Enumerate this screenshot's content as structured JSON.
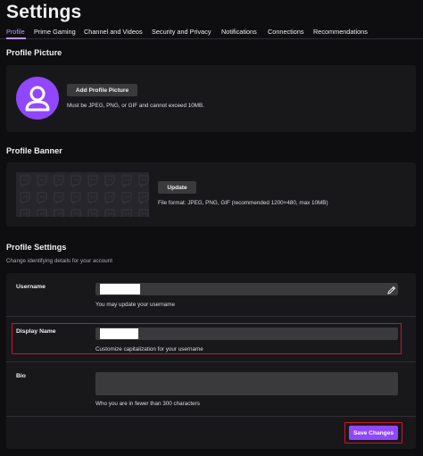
{
  "page": {
    "title": "Settings"
  },
  "tabs": [
    {
      "label": "Profile",
      "active": true
    },
    {
      "label": "Prime Gaming"
    },
    {
      "label": "Channel and Videos"
    },
    {
      "label": "Security and Privacy"
    },
    {
      "label": "Notifications"
    },
    {
      "label": "Connections"
    },
    {
      "label": "Recommendations"
    }
  ],
  "profile_picture": {
    "heading": "Profile Picture",
    "button": "Add Profile Picture",
    "hint": "Must be JPEG, PNG, or GIF and cannot exceed 10MB.",
    "icon": "user-icon"
  },
  "profile_banner": {
    "heading": "Profile Banner",
    "button": "Update",
    "hint": "File format: JPEG, PNG, GIF (recommended 1200×480, max 10MB)"
  },
  "profile_settings": {
    "heading": "Profile Settings",
    "subheading": "Change identifying details for your account",
    "username": {
      "label": "Username",
      "hint": "You may update your username",
      "value": ""
    },
    "display_name": {
      "label": "Display Name",
      "hint": "Customize capitalization for your username",
      "value": ""
    },
    "bio": {
      "label": "Bio",
      "hint": "Who you are in fewer than 300 characters",
      "value": ""
    },
    "save_button": "Save Changes"
  },
  "colors": {
    "accent": "#9147ff",
    "accent_text": "#bf94ff",
    "highlight": "#d0112b",
    "background": "#0e0e10",
    "panel": "#18181b"
  }
}
